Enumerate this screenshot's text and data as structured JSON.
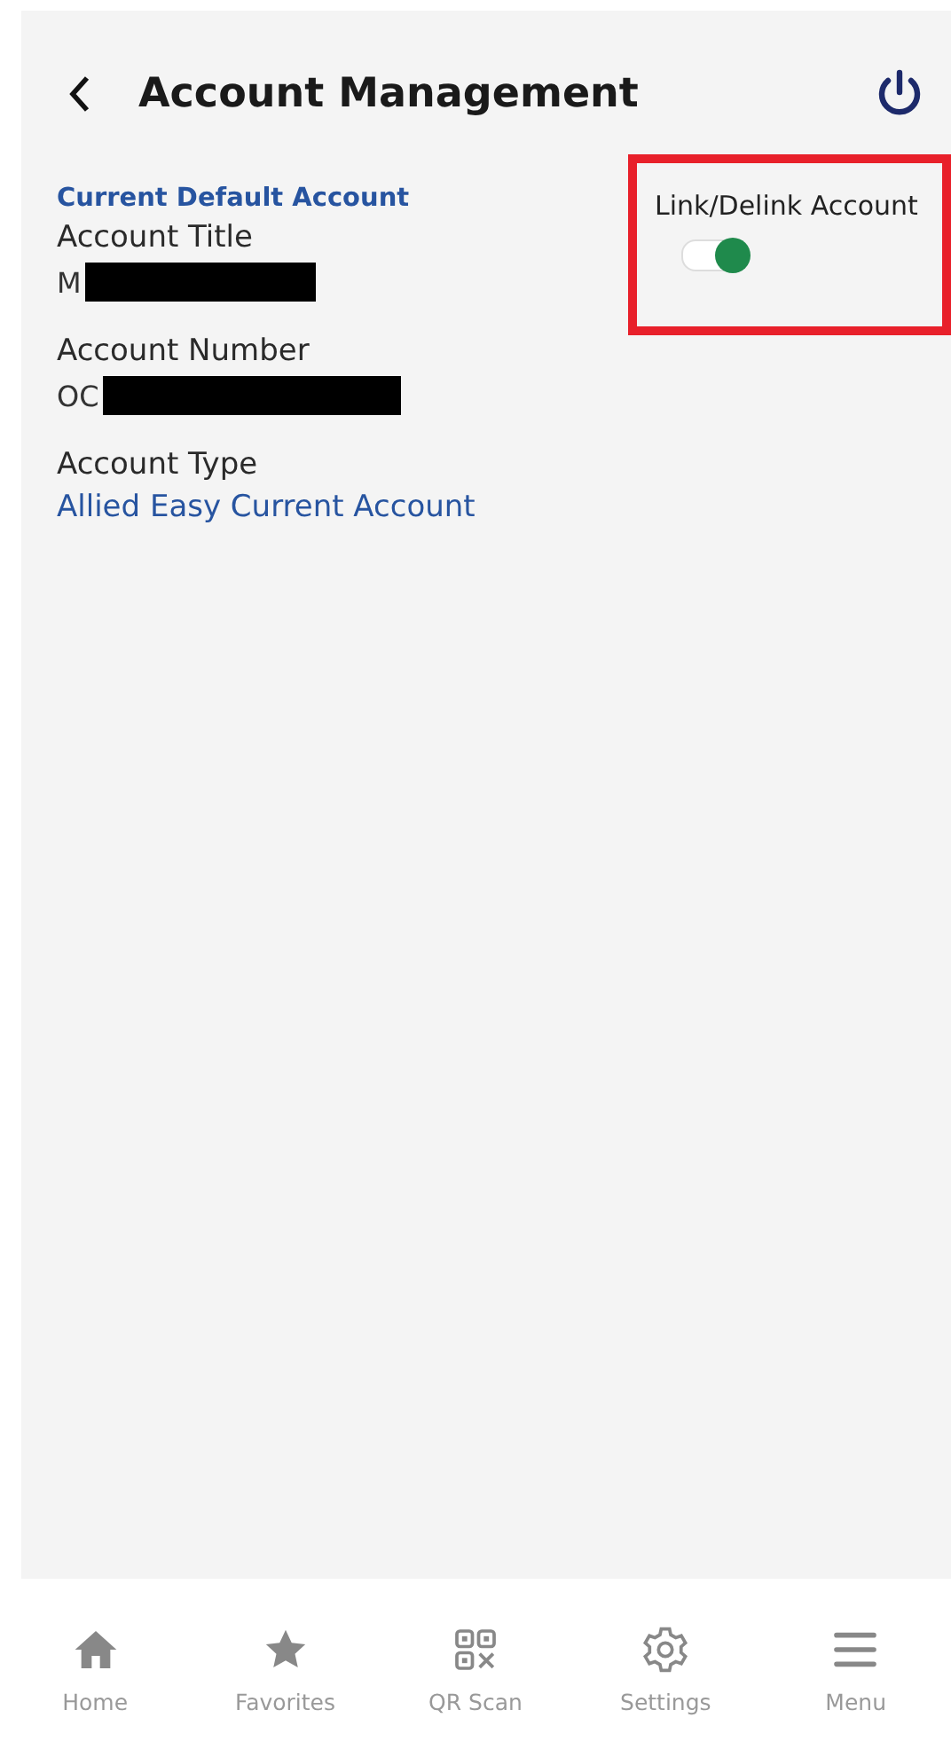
{
  "header": {
    "title": "Account Management"
  },
  "account": {
    "section_title": "Current Default Account",
    "fields": [
      {
        "label": "Account Title",
        "value": "M",
        "redacted": true,
        "kind": "plain"
      },
      {
        "label": "Account Number",
        "value": "OC",
        "redacted": true,
        "kind": "plain"
      },
      {
        "label": "Account Type",
        "value": "Allied Easy Current Account",
        "redacted": false,
        "kind": "link"
      }
    ]
  },
  "link_toggle": {
    "label": "Link/Delink Account",
    "on": true,
    "highlighted": true
  },
  "bottom_nav": [
    {
      "label": "Home",
      "kind": "home"
    },
    {
      "label": "Favorites",
      "kind": "star"
    },
    {
      "label": "QR Scan",
      "kind": "qr"
    },
    {
      "label": "Settings",
      "kind": "gear"
    },
    {
      "label": "Menu",
      "kind": "menu"
    }
  ]
}
